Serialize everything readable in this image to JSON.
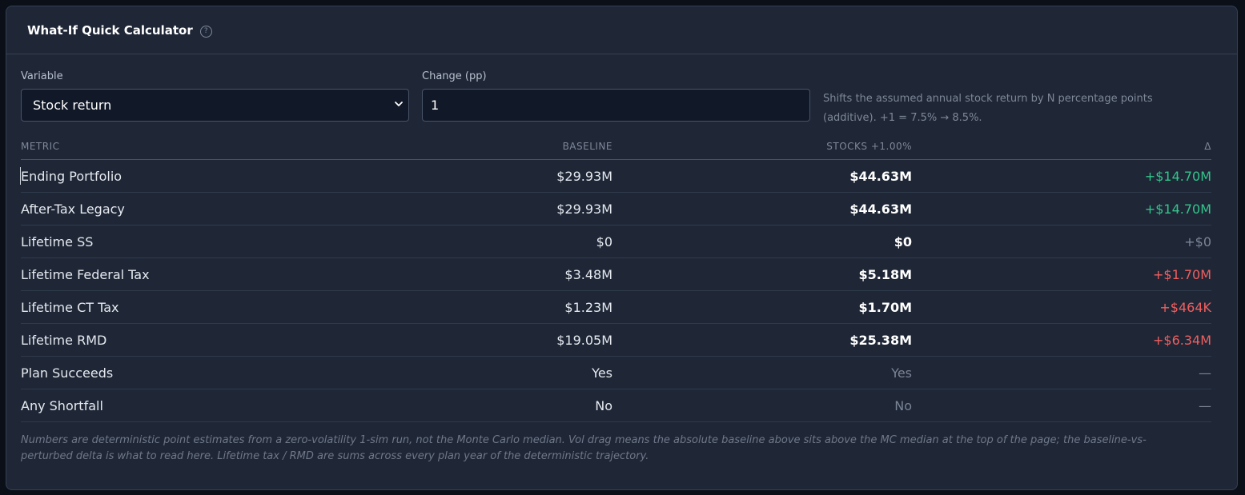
{
  "card": {
    "title": "What-If Quick Calculator",
    "help_icon": "question-circle-icon"
  },
  "controls": {
    "variable_label": "Variable",
    "variable_value": "Stock return",
    "change_label": "Change (pp)",
    "change_value": "1",
    "hint": "Shifts the assumed annual stock return by N percentage points (additive). +1 = 7.5% → 8.5%."
  },
  "table": {
    "headers": {
      "metric": "METRIC",
      "baseline": "BASELINE",
      "perturbed": "STOCKS +1.00%",
      "delta": "Δ"
    },
    "rows": [
      {
        "metric": "Ending Portfolio",
        "baseline": "$29.93M",
        "perturbed": "$44.63M",
        "delta": "+$14.70M"
      },
      {
        "metric": "After-Tax Legacy",
        "baseline": "$29.93M",
        "perturbed": "$44.63M",
        "delta": "+$14.70M"
      },
      {
        "metric": "Lifetime SS",
        "baseline": "$0",
        "perturbed": "$0",
        "delta": "+$0"
      },
      {
        "metric": "Lifetime Federal Tax",
        "baseline": "$3.48M",
        "perturbed": "$5.18M",
        "delta": "+$1.70M"
      },
      {
        "metric": "Lifetime CT Tax",
        "baseline": "$1.23M",
        "perturbed": "$1.70M",
        "delta": "+$464K"
      },
      {
        "metric": "Lifetime RMD",
        "baseline": "$19.05M",
        "perturbed": "$25.38M",
        "delta": "+$6.34M"
      },
      {
        "metric": "Plan Succeeds",
        "baseline": "Yes",
        "perturbed": "Yes",
        "delta": "—"
      },
      {
        "metric": "Any Shortfall",
        "baseline": "No",
        "perturbed": "No",
        "delta": "—"
      }
    ]
  },
  "footnote": "Numbers are deterministic point estimates from a zero-volatility 1-sim run, not the Monte Carlo median. Vol drag means the absolute baseline above sits above the MC median at the top of the page; the baseline-vs-perturbed delta is what to read here. Lifetime tax / RMD are sums across every plan year of the deterministic trajectory.",
  "colors": {
    "positive": "#34c48b",
    "negative": "#ef5f5f",
    "neutral": "#7a8494"
  }
}
